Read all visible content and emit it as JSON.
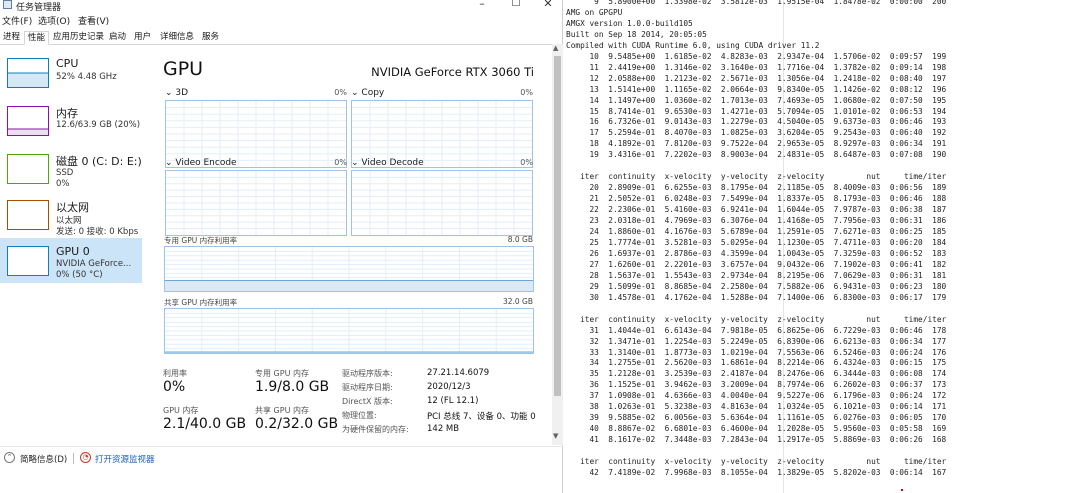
{
  "window": {
    "title": "任务管理器",
    "menu": [
      "文件(F)",
      "选项(O)",
      "查看(V)"
    ],
    "tabs": [
      "进程",
      "性能",
      "应用历史记录",
      "启动",
      "用户",
      "详细信息",
      "服务"
    ],
    "active_tab": "性能"
  },
  "sidebar": {
    "items": [
      {
        "title": "CPU",
        "sub1": "52% 4.48 GHz",
        "sub2": "",
        "color": "#117dbb"
      },
      {
        "title": "内存",
        "sub1": "12.6/63.9 GB (20%)",
        "sub2": "",
        "color": "#8b12ae"
      },
      {
        "title": "磁盘 0 (C: D: E:)",
        "sub1": "SSD",
        "sub2": "0%",
        "color": "#4da60c"
      },
      {
        "title": "以太网",
        "sub1": "以太网",
        "sub2": "发送: 0 接收: 0 Kbps",
        "color": "#a74f01"
      },
      {
        "title": "GPU 0",
        "sub1": "NVIDIA GeForce...",
        "sub2": "0% (50 °C)",
        "color": "#117dbb"
      }
    ],
    "selected_index": 4
  },
  "gpu": {
    "title": "GPU",
    "model": "NVIDIA GeForce RTX 3060 Ti",
    "engines": [
      {
        "label": "3D",
        "percent": "0%"
      },
      {
        "label": "Copy",
        "percent": "0%"
      },
      {
        "label": "Video Encode",
        "percent": "0%"
      },
      {
        "label": "Video Decode",
        "percent": "0%"
      }
    ],
    "dedicated_memory": {
      "label": "专用 GPU 内存利用率",
      "max": "8.0 GB",
      "fill_fraction": 0.24
    },
    "shared_memory": {
      "label": "共享 GPU 内存利用率",
      "max": "32.0 GB",
      "fill_fraction": 0.006
    },
    "stats": {
      "utilization_label": "利用率",
      "utilization": "0%",
      "dedicated_label": "专用 GPU 内存",
      "dedicated": "1.9/8.0 GB",
      "gpu_memory_label": "GPU 内存",
      "gpu_memory": "2.1/40.0 GB",
      "shared_label": "共享 GPU 内存",
      "shared": "0.2/32.0 GB"
    },
    "info": [
      {
        "key": "驱动程序版本:",
        "value": "27.21.14.6079"
      },
      {
        "key": "驱动程序日期:",
        "value": "2020/12/3"
      },
      {
        "key": "DirectX 版本:",
        "value": "12 (FL 12.1)"
      },
      {
        "key": "物理位置:",
        "value": "PCI 总线 7、设备 0、功能 0"
      },
      {
        "key": "为硬件保留的内存:",
        "value": "142 MB"
      }
    ]
  },
  "footer": {
    "less_details": "简略信息(D)",
    "resource_monitor": "打开资源监视器"
  },
  "terminal": {
    "lines": [
      "      9  5.8900e+00  1.3398e-02  3.5812e-03  1.9515e-04  1.8478e-02  0:00:00  200",
      "AMG on GPGPU",
      "AMGX version 1.0.0-build105",
      "Built on Sep 18 2014, 20:05:05",
      "Compiled with CUDA Runtime 6.0, using CUDA driver 11.2",
      "     10  9.5485e+00  1.6185e-02  4.8283e-03  2.9347e-04  1.5706e-02  0:09:57  199",
      "     11  2.4419e+00  1.3146e-02  3.1640e-03  1.7716e-04  1.3782e-02  0:09:14  198",
      "     12  2.0588e+00  1.2123e-02  2.5671e-03  1.3056e-04  1.2418e-02  0:08:40  197",
      "     13  1.5141e+00  1.1165e-02  2.0664e-03  9.8340e-05  1.1426e-02  0:08:12  196",
      "     14  1.1497e+00  1.0360e-02  1.7013e-03  7.4693e-05  1.0680e-02  0:07:50  195",
      "     15  8.7414e-01  9.6530e-03  1.4271e-03  5.7094e-05  1.0101e-02  0:06:53  194",
      "     16  6.7326e-01  9.0143e-03  1.2279e-03  4.5040e-05  9.6373e-03  0:06:46  193",
      "     17  5.2594e-01  8.4070e-03  1.0825e-03  3.6204e-05  9.2543e-03  0:06:40  192",
      "     18  4.1892e-01  7.8120e-03  9.7522e-04  2.9653e-05  8.9297e-03  0:06:34  191",
      "     19  3.4316e-01  7.2202e-03  8.9003e-04  2.4831e-05  8.6487e-03  0:07:08  190",
      "",
      "   iter  continuity  x-velocity  y-velocity  z-velocity         nut     time/iter",
      "     20  2.8909e-01  6.6255e-03  8.1795e-04  2.1185e-05  8.4009e-03  0:06:56  189",
      "     21  2.5052e-01  6.0248e-03  7.5499e-04  1.8337e-05  8.1793e-03  0:06:46  188",
      "     22  2.2306e-01  5.4160e-03  6.9241e-04  1.6044e-05  7.9787e-03  0:06:38  187",
      "     23  2.0318e-01  4.7969e-03  6.3076e-04  1.4168e-05  7.7956e-03  0:06:31  186",
      "     24  1.8860e-01  4.1676e-03  5.6789e-04  1.2591e-05  7.6271e-03  0:06:25  185",
      "     25  1.7774e-01  3.5281e-03  5.0295e-04  1.1230e-05  7.4711e-03  0:06:20  184",
      "     26  1.6937e-01  2.8786e-03  4.3599e-04  1.0043e-05  7.3259e-03  0:06:52  183",
      "     27  1.6260e-01  2.2201e-03  3.6757e-04  9.0432e-06  7.1902e-03  0:06:41  182",
      "     28  1.5637e-01  1.5543e-03  2.9734e-04  8.2195e-06  7.0629e-03  0:06:31  181",
      "     29  1.5099e-01  8.8685e-04  2.2580e-04  7.5882e-06  6.9431e-03  0:06:23  180",
      "     30  1.4578e-01  4.1762e-04  1.5288e-04  7.1400e-06  6.8300e-03  0:06:17  179",
      "",
      "   iter  continuity  x-velocity  y-velocity  z-velocity         nut     time/iter",
      "     31  1.4044e-01  6.6143e-04  7.9818e-05  6.8625e-06  6.7229e-03  0:06:46  178",
      "     32  1.3471e-01  1.2254e-03  5.2249e-05  6.8390e-06  6.6213e-03  0:06:34  177",
      "     33  1.3140e-01  1.8773e-03  1.0219e-04  7.5563e-06  6.5246e-03  0:06:24  176",
      "     34  1.2755e-01  2.5620e-03  1.6861e-04  8.2214e-06  6.4324e-03  0:06:15  175",
      "     35  1.2128e-01  3.2539e-03  2.4187e-04  8.2476e-06  6.3444e-03  0:06:08  174",
      "     36  1.1525e-01  3.9462e-03  3.2009e-04  8.7974e-06  6.2602e-03  0:06:37  173",
      "     37  1.0908e-01  4.6366e-03  4.0040e-04  9.5227e-06  6.1796e-03  0:06:24  172",
      "     38  1.0263e-01  5.3238e-03  4.8163e-04  1.0324e-05  6.1021e-03  0:06:14  171",
      "     39  9.5885e-02  6.0056e-03  5.6364e-04  1.1161e-05  6.0276e-03  0:06:05  170",
      "     40  8.8867e-02  6.6801e-03  6.4600e-04  1.2028e-05  5.9560e-03  0:05:58  169",
      "     41  8.1617e-02  7.3448e-03  7.2843e-04  1.2917e-05  5.8869e-03  0:06:26  168",
      "",
      "   iter  continuity  x-velocity  y-velocity  z-velocity         nut     time/iter",
      "     42  7.4189e-02  7.9968e-03  8.1055e-04  1.3829e-05  5.8202e-03  0:06:14  167"
    ]
  }
}
